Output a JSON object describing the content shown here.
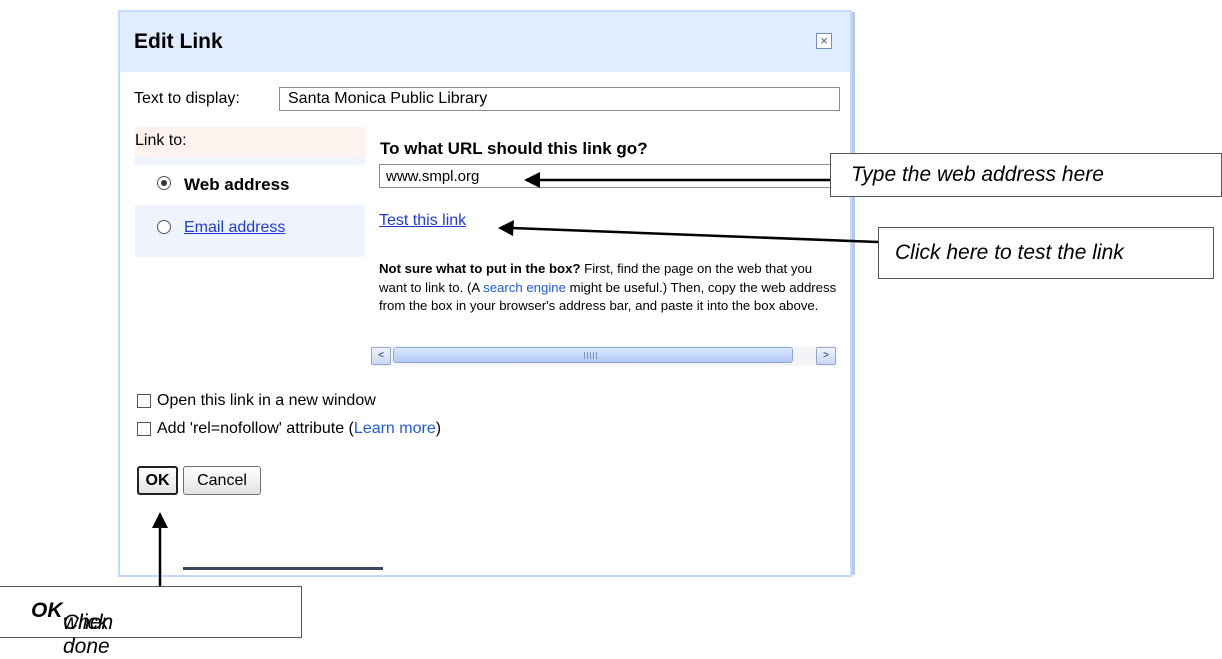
{
  "dialog": {
    "title": "Edit Link",
    "close_glyph": "×",
    "text_to_display_label": "Text to display:",
    "text_to_display_value": "Santa Monica Public Library",
    "link_to_label": "Link to:",
    "options": [
      {
        "label": "Web address",
        "selected": true
      },
      {
        "label": "Email address",
        "selected": false
      }
    ],
    "url_question": "To what URL should this link go?",
    "url_value": "www.smpl.org",
    "test_link": "Test this link",
    "help": {
      "bold": "Not sure what to put in the box?",
      "part1": " First, find the page on the web that you want to link to. (A ",
      "link": "search engine",
      "part2": " might be useful.) Then, copy the web address from the box in your browser's address bar, and paste it into the box above."
    },
    "scrollbar": {
      "left_arrow": "<",
      "right_arrow": ">"
    },
    "checkbox_new_window": "Open this link in a new window",
    "checkbox_nofollow_prefix": "Add 'rel=nofollow' attribute (",
    "learn_more": "Learn more",
    "checkbox_nofollow_suffix": ")",
    "ok_label": "OK",
    "cancel_label": "Cancel"
  },
  "callouts": {
    "web_address": "Type the web address here",
    "test_link": "Click here to test the link",
    "ok_prefix": "Click ",
    "ok_bold": "OK",
    "ok_suffix": " when done"
  }
}
